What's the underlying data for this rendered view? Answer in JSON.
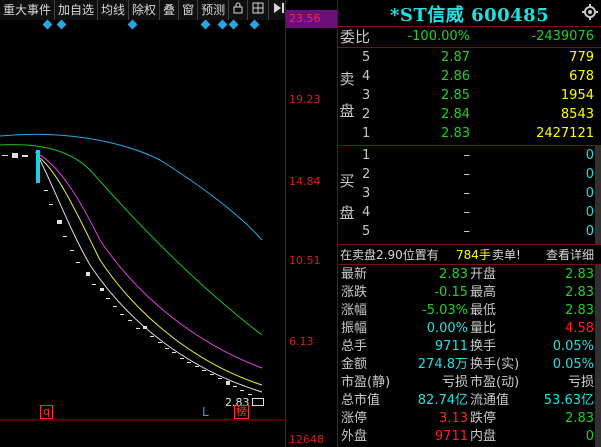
{
  "toolbar": {
    "items": [
      "重大事件",
      "加自选",
      "均线",
      "除权",
      "叠",
      "窗",
      "预测"
    ],
    "icons": [
      "lock-icon",
      "grid-icon",
      "play-icon",
      "chevron-down-icon"
    ]
  },
  "price_axis": {
    "top": "23.56",
    "labels": [
      "19.23",
      "14.84",
      "10.51",
      "6.13",
      "12648"
    ]
  },
  "chart_labels": {
    "last_price": "2.83",
    "marker_q": "q",
    "marker_l": "L",
    "marker_bang": "榜"
  },
  "colors": {
    "up": "#ff2020",
    "down": "#20d020",
    "neutral": "#20e0e0",
    "volume": "#ffff00",
    "border": "#7a1010",
    "title": "#20e0e0"
  },
  "title": {
    "stock": "*ST信威 600485"
  },
  "order_ratio": {
    "label": "委比",
    "percent": "-100.00%",
    "diff": "-2439076"
  },
  "sell": {
    "label": [
      "卖",
      "盘"
    ],
    "levels": [
      {
        "idx": "5",
        "price": "2.87",
        "vol": "779"
      },
      {
        "idx": "4",
        "price": "2.86",
        "vol": "678"
      },
      {
        "idx": "3",
        "price": "2.85",
        "vol": "1954"
      },
      {
        "idx": "2",
        "price": "2.84",
        "vol": "8543"
      },
      {
        "idx": "1",
        "price": "2.83",
        "vol": "2427121"
      }
    ]
  },
  "buy": {
    "label": [
      "买",
      "盘"
    ],
    "levels": [
      {
        "idx": "1",
        "price": "–",
        "vol": "0"
      },
      {
        "idx": "2",
        "price": "–",
        "vol": "0"
      },
      {
        "idx": "3",
        "price": "–",
        "vol": "0"
      },
      {
        "idx": "4",
        "price": "–",
        "vol": "0"
      },
      {
        "idx": "5",
        "price": "–",
        "vol": "0"
      }
    ]
  },
  "notice": {
    "text": "在卖盘2.90位置有",
    "amount": "784手",
    "action": "卖单!",
    "detail": "查看详细"
  },
  "stats": [
    {
      "l1": "最新",
      "v1": "2.83",
      "c1": "g",
      "l2": "开盘",
      "v2": "2.83",
      "c2": "g"
    },
    {
      "l1": "涨跌",
      "v1": "-0.15",
      "c1": "g",
      "l2": "最高",
      "v2": "2.83",
      "c2": "g"
    },
    {
      "l1": "涨幅",
      "v1": "-5.03%",
      "c1": "g",
      "l2": "最低",
      "v2": "2.83",
      "c2": "g"
    },
    {
      "l1": "振幅",
      "v1": "0.00%",
      "c1": "c",
      "l2": "量比",
      "v2": "4.58",
      "c2": "r"
    },
    {
      "l1": "总手",
      "v1": "9711",
      "c1": "c",
      "l2": "换手",
      "v2": "0.05%",
      "c2": "c"
    },
    {
      "l1": "金额",
      "v1": "274.8万",
      "c1": "c",
      "l2": "换手(实)",
      "v2": "0.05%",
      "c2": "c"
    },
    {
      "l1": "市盈(静)",
      "v1": "亏损",
      "c1": "w",
      "l2": "市盈(动)",
      "v2": "亏损",
      "c2": "w"
    },
    {
      "l1": "总市值",
      "v1": "82.74亿",
      "c1": "c",
      "l2": "流通值",
      "v2": "53.63亿",
      "c2": "c"
    },
    {
      "l1": "涨停",
      "v1": "3.13",
      "c1": "r",
      "l2": "跌停",
      "v2": "2.83",
      "c2": "g"
    },
    {
      "l1": "外盘",
      "v1": "9711",
      "c1": "r",
      "l2": "内盘",
      "v2": "0",
      "c2": "g"
    }
  ]
}
